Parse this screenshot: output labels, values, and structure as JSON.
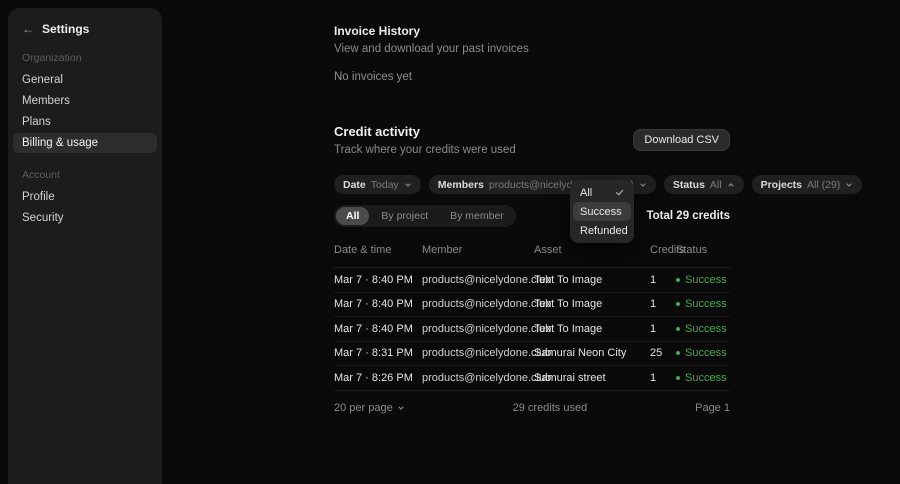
{
  "colors": {
    "page_bg": "#0a0a0b",
    "sidebar_bg": "#1c1c1d",
    "sidebar_selected_bg": "#2d2d2e",
    "accent_success": "#45a64d",
    "dropdown_bg": "#272728",
    "dropdown_highlight": "#3c3c3d"
  },
  "sidebar": {
    "back_icon": "←",
    "title": "Settings",
    "sections": [
      {
        "label": "Organization",
        "items": [
          {
            "label": "General"
          },
          {
            "label": "Members"
          },
          {
            "label": "Plans"
          },
          {
            "label": "Billing & usage"
          }
        ]
      },
      {
        "label": "Account",
        "items": [
          {
            "label": "Profile"
          },
          {
            "label": "Security"
          }
        ]
      }
    ]
  },
  "invoice_section": {
    "title": "Invoice History",
    "subtitle": "View and download your past invoices",
    "empty_text": "No invoices yet"
  },
  "credit_section": {
    "title": "Credit activity",
    "subtitle": "Track where your credits were used",
    "download_button": "Download CSV",
    "filters": [
      {
        "label": "Date",
        "value": "Today"
      },
      {
        "label": "Members",
        "value": "products@nicelydone.club (29)"
      },
      {
        "label": "Status",
        "value": "All"
      },
      {
        "label": "Projects",
        "value": "All (29)"
      }
    ],
    "status_dropdown": {
      "items": [
        {
          "label": "All"
        },
        {
          "label": "Success"
        },
        {
          "label": "Refunded"
        }
      ]
    },
    "tabs": [
      {
        "label": "All"
      },
      {
        "label": "By project"
      },
      {
        "label": "By member"
      }
    ],
    "total_text": "Total 29 credits",
    "table": {
      "columns": [
        "Date & time",
        "Member",
        "Asset",
        "Credits",
        "Status"
      ],
      "rows": [
        {
          "datetime": "Mar 7 · 8:40 PM",
          "member": "products@nicelydone.club",
          "asset": "Text To Image",
          "credits": "1",
          "status": "Success"
        },
        {
          "datetime": "Mar 7 · 8:40 PM",
          "member": "products@nicelydone.club",
          "asset": "Text To Image",
          "credits": "1",
          "status": "Success"
        },
        {
          "datetime": "Mar 7 · 8:40 PM",
          "member": "products@nicelydone.club",
          "asset": "Text To Image",
          "credits": "1",
          "status": "Success"
        },
        {
          "datetime": "Mar 7 · 8:31 PM",
          "member": "products@nicelydone.club",
          "asset": "Samurai Neon City",
          "credits": "25",
          "status": "Success"
        },
        {
          "datetime": "Mar 7 · 8:26 PM",
          "member": "products@nicelydone.club",
          "asset": "Samurai street",
          "credits": "1",
          "status": "Success"
        }
      ]
    },
    "footer": {
      "per_page": "20 per page",
      "credits_used": "29 credits used",
      "page": "Page 1"
    }
  }
}
